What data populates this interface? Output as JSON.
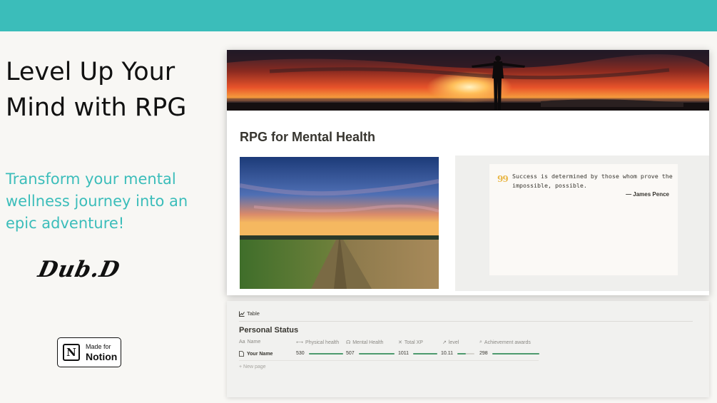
{
  "banner": {
    "color": "#3bbdba"
  },
  "hero": {
    "headline_line1": "Level Up Your",
    "headline_line2": "Mind with RPG",
    "tagline_line1": "Transform your mental",
    "tagline_line2": "wellness journey into an",
    "tagline_line3": "epic adventure!",
    "signature": "Dub.D"
  },
  "badge": {
    "small": "Made for",
    "big": "Notion",
    "logo_letter": "N"
  },
  "page": {
    "title": "RPG for Mental Health",
    "quote_icon": "99",
    "quote_line1": "Success is determined by those whom prove the",
    "quote_line2": "impossible, possible.",
    "quote_author": "— James Pence"
  },
  "database": {
    "view_label": "Table",
    "title": "Personal Status",
    "columns": {
      "name": "Name",
      "physical": "Physical health",
      "mental": "Mental Health",
      "xp": "Total XP",
      "level": "level",
      "awards": "Achievement awards"
    },
    "row": {
      "name": "Your Name",
      "physical": "530",
      "physical_fill": 1.0,
      "mental": "507",
      "mental_fill": 1.0,
      "xp": "1011",
      "xp_fill": 1.0,
      "level": "10.11",
      "level_fill": 0.5,
      "awards": "298",
      "awards_fill": 1.0
    },
    "new_page": "New page"
  },
  "icons": {
    "table": "table-chart-icon",
    "name_col": "text-aa-icon",
    "physical_col": "dumbbell-icon",
    "mental_col": "brain-icon",
    "xp_col": "sigma-icon",
    "level_col": "chart-icon",
    "awards_col": "search-icon",
    "page": "page-icon"
  },
  "colors": {
    "accent": "#3bbdba",
    "progress": "#4d9a6e",
    "quote_icon": "#e9b84a"
  }
}
